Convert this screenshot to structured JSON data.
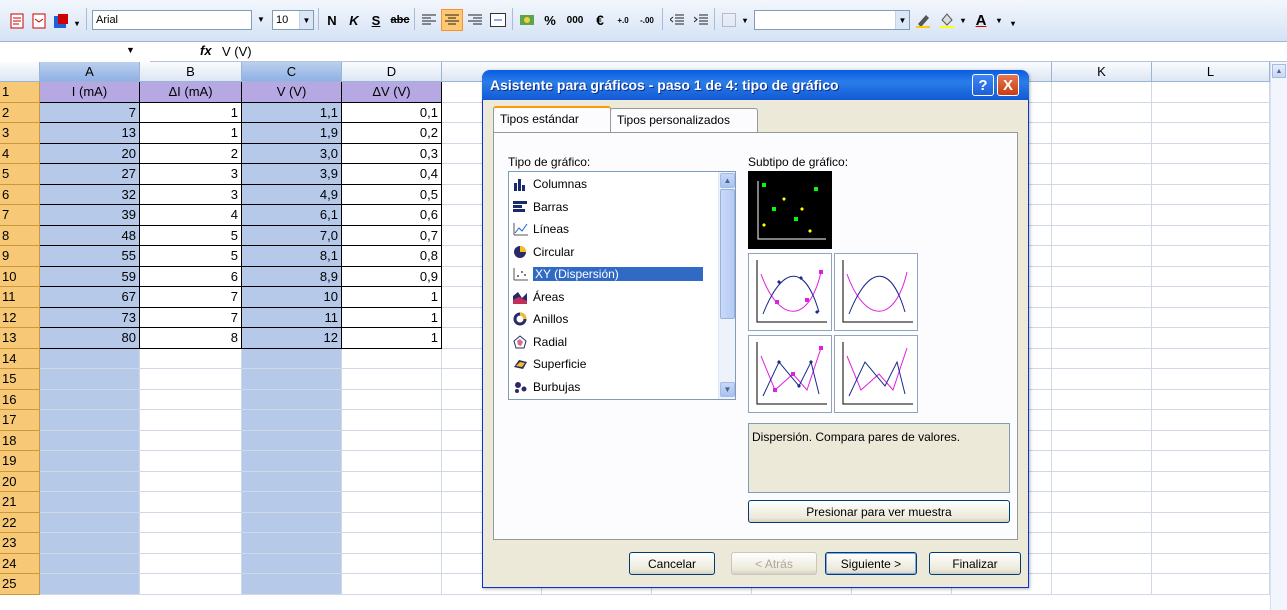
{
  "toolbar": {
    "font_name": "Arial",
    "font_size": "10",
    "bold": "N",
    "italic": "K",
    "underline": "S",
    "strike": "abc",
    "percent": "%",
    "thousands": "000",
    "euro": "€",
    "font_color_icon": "A"
  },
  "formula_bar": {
    "fx": "fx",
    "value": "V (V)"
  },
  "columns": [
    "A",
    "B",
    "C",
    "D",
    "K",
    "L"
  ],
  "rows": [
    "1",
    "2",
    "3",
    "4",
    "5",
    "6",
    "7",
    "8",
    "9",
    "10",
    "11",
    "12",
    "13",
    "14",
    "15",
    "16",
    "17",
    "18",
    "19",
    "20",
    "21",
    "22",
    "23",
    "24",
    "25"
  ],
  "sheet": {
    "headers": [
      "I (mA)",
      "ΔI (mA)",
      "V (V)",
      "ΔV (V)"
    ],
    "data": [
      [
        "7",
        "1",
        "1,1",
        "0,1"
      ],
      [
        "13",
        "1",
        "1,9",
        "0,2"
      ],
      [
        "20",
        "2",
        "3,0",
        "0,3"
      ],
      [
        "27",
        "3",
        "3,9",
        "0,4"
      ],
      [
        "32",
        "3",
        "4,9",
        "0,5"
      ],
      [
        "39",
        "4",
        "6,1",
        "0,6"
      ],
      [
        "48",
        "5",
        "7,0",
        "0,7"
      ],
      [
        "55",
        "5",
        "8,1",
        "0,8"
      ],
      [
        "59",
        "6",
        "8,9",
        "0,9"
      ],
      [
        "67",
        "7",
        "10",
        "1"
      ],
      [
        "73",
        "7",
        "11",
        "1"
      ],
      [
        "80",
        "8",
        "12",
        "1"
      ]
    ]
  },
  "dialog": {
    "title": "Asistente para gráficos - paso 1 de 4: tipo de gráfico",
    "help": "?",
    "close": "X",
    "tabs": [
      "Tipos estándar",
      "Tipos personalizados"
    ],
    "chart_type_label": "Tipo de gráfico:",
    "subtype_label": "Subtipo de gráfico:",
    "chart_types": [
      "Columnas",
      "Barras",
      "Líneas",
      "Circular",
      "XY (Dispersión)",
      "Áreas",
      "Anillos",
      "Radial",
      "Superficie",
      "Burbujas"
    ],
    "selected_type": "XY (Dispersión)",
    "description": "Dispersión. Compara pares de valores.",
    "preview_button": "Presionar para ver muestra",
    "buttons": {
      "cancel": "Cancelar",
      "back": "< Atrás",
      "next": "Siguiente >",
      "finish": "Finalizar"
    }
  }
}
